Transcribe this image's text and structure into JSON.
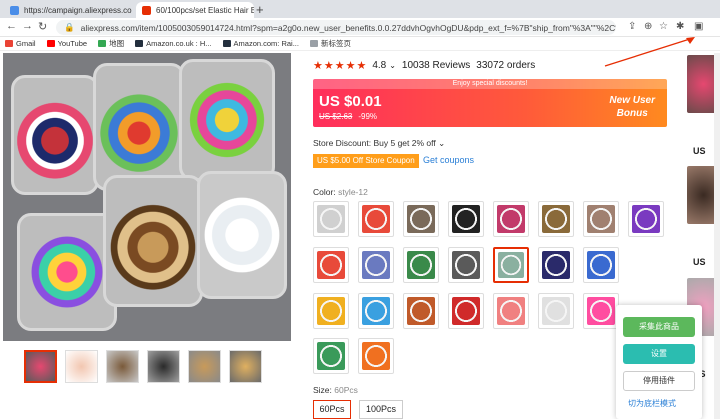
{
  "browser": {
    "tabs": [
      {
        "label": "https://campaign.aliexpress.co",
        "favicon_color": "#4a8de8"
      },
      {
        "label": "60/100pcs/set Elastic Hair Ban",
        "favicon_color": "#e62e04"
      }
    ],
    "new_tab": "+",
    "url": "aliexpress.com/item/1005003059014724.html?spm=a2g0o.new_user_benefits.0.0.27ddvhOgvhOgDU&pdp_ext_f=%7B\"ship_from\"%3A\"\"%2C\"sku_id\"%3A\"12...",
    "bookmarks": [
      {
        "label": "Gmail",
        "color": "#ea4335"
      },
      {
        "label": "YouTube",
        "color": "#ff0000"
      },
      {
        "label": "地图",
        "color": "#34a853"
      },
      {
        "label": "Amazon.co.uk : H...",
        "color": "#232f3e"
      },
      {
        "label": "Amazon.com: Rai...",
        "color": "#232f3e"
      },
      {
        "label": "新标签页",
        "color": "#9aa0a6"
      }
    ]
  },
  "product": {
    "rating": "4.8",
    "reviews": "10038 Reviews",
    "orders": "33072 orders",
    "price_banner": "Enjoy special discounts!",
    "price": "US $0.01",
    "old_price": "US $2.63",
    "discount": "-99%",
    "new_user_line1": "New User",
    "new_user_line2": "Bonus",
    "store_discount": "Store Discount: Buy 5 get 2% off",
    "coupon": "US $5.00 Off Store Coupon",
    "get_coupons": "Get coupons",
    "color_label": "Color:",
    "color_value": "style-12",
    "size_label": "Size:",
    "size_value": "60Pcs",
    "sizes": [
      "60Pcs",
      "100Pcs"
    ],
    "accent_color": "#e62e04"
  },
  "right_column": {
    "labels": [
      "US",
      "US",
      "US"
    ]
  },
  "plugin_panel": {
    "collect_button": "采集此商品",
    "settings_button": "设置",
    "disable_button": "停用插件",
    "bottom_link": "切为底栏模式"
  }
}
